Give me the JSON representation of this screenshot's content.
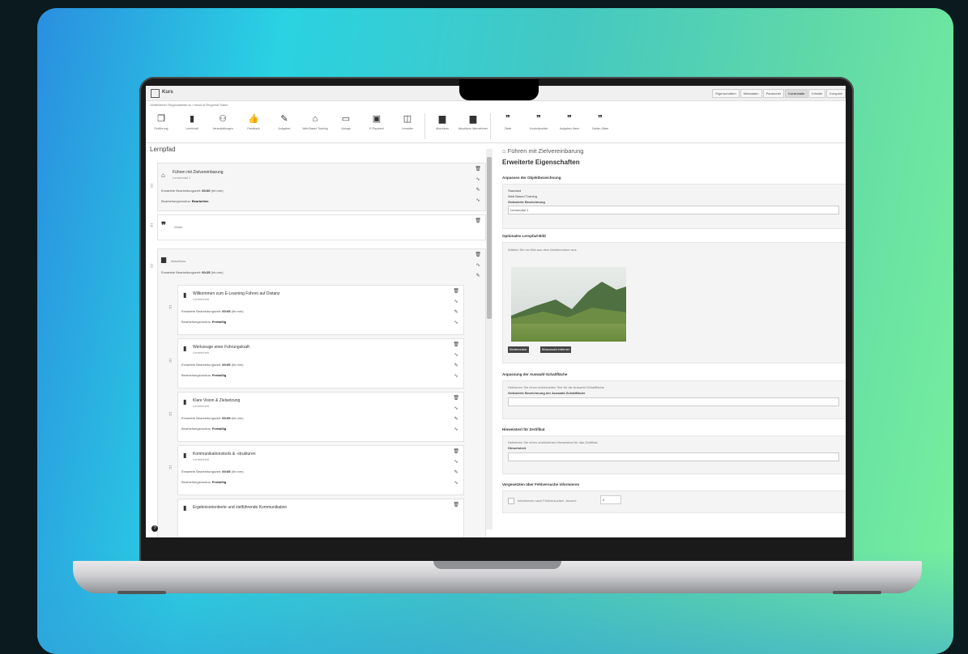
{
  "window": {
    "title": "Kurs"
  },
  "tabs": [
    "Eigenschaften",
    "Metadaten",
    "Parameter",
    "Kursinhalte",
    "Infosite",
    "Kursplan"
  ],
  "breadcrumb": "Zertifizierter Regionalleiter:in / Head of Regional Sales",
  "toolbar": [
    {
      "icon": "document-icon",
      "label": "Einführung",
      "glyph": "❐"
    },
    {
      "icon": "book-icon",
      "label": "Lerninhalt",
      "glyph": "▮"
    },
    {
      "icon": "people-icon",
      "label": "Veranstaltungen",
      "glyph": "⚇"
    },
    {
      "icon": "thumbs-up-icon",
      "label": "Feedback",
      "glyph": "👍"
    },
    {
      "icon": "pen-icon",
      "label": "Aufgaben",
      "glyph": "✎"
    },
    {
      "icon": "robot-icon",
      "label": "Web Based Training",
      "glyph": "⌂"
    },
    {
      "icon": "window-icon",
      "label": "Vorlage",
      "glyph": "▭"
    },
    {
      "icon": "card-icon",
      "label": "E-Payment",
      "glyph": "▣"
    },
    {
      "icon": "box-icon",
      "label": "Lernziele",
      "glyph": "◫"
    },
    {
      "icon": "monitor-icon",
      "label": "Abschluss",
      "glyph": "▆"
    },
    {
      "icon": "user-icon",
      "label": "Abschluss übernehmen",
      "glyph": "▆"
    },
    {
      "icon": "quote-icon",
      "label": "Zitate",
      "glyph": "❞"
    },
    {
      "icon": "quote-icon",
      "label": "Kontrollpunkte",
      "glyph": "❞"
    },
    {
      "icon": "quote-icon",
      "label": "Aufgaben lösen",
      "glyph": "❞"
    },
    {
      "icon": "quote-icon",
      "label": "Zahlen Zitate",
      "glyph": "❞"
    }
  ],
  "left": {
    "heading": "Lernpfad",
    "cards": [
      {
        "title": "Führen mit Zielvereinbarung",
        "subtitle": "Lernmodul 1",
        "meta1_label": "Erwartete Bearbeitungszeit:",
        "meta1_value": "00:00",
        "meta1_unit": "hh:mm",
        "meta2_label": "Bearbeitungsmodus:",
        "meta2_value": "Bearbeiten"
      },
      {
        "title": "Zitate"
      },
      {
        "title": "Abschluss",
        "meta1_label": "Erwartete Bearbeitungszeit:",
        "meta1_value": "00:25",
        "meta1_unit": "hh:mm"
      }
    ],
    "subcards": [
      {
        "title": "Willkommen zum E-Learning Führen auf Distanz",
        "subtitle": "Lerneinheit",
        "meta1_label": "Erwartete Bearbeitungszeit:",
        "meta1_value": "00:05",
        "meta1_unit": "hh:mm",
        "meta2_label": "Bearbeitungsmodus:",
        "meta2_value": "Freiwillig"
      },
      {
        "title": "Werkzeuge einer Führungskraft",
        "subtitle": "Lerneinheit",
        "meta1_label": "Erwartete Bearbeitungszeit:",
        "meta1_value": "00:05",
        "meta1_unit": "hh:mm",
        "meta2_label": "Bearbeitungsmodus:",
        "meta2_value": "Freiwillig"
      },
      {
        "title": "Klare Vision & Zielsetzung",
        "subtitle": "Lerneinheit",
        "meta1_label": "Erwartete Bearbeitungszeit:",
        "meta1_value": "00:05",
        "meta1_unit": "hh:mm",
        "meta2_label": "Bearbeitungsmodus:",
        "meta2_value": "Freiwillig"
      },
      {
        "title": "Kommunikationstools & -strukturen",
        "subtitle": "Lerneinheit",
        "meta1_label": "Erwartete Bearbeitungszeit:",
        "meta1_value": "00:05",
        "meta1_unit": "hh:mm",
        "meta2_label": "Bearbeitungsmodus:",
        "meta2_value": "Freiwillig"
      },
      {
        "title": "Ergebnisorientierte und zielführende Kommunikation"
      }
    ]
  },
  "right": {
    "header": "Führen mit Zielvereinbarung",
    "title": "Erweiterte Eigenschaften",
    "s1": {
      "heading": "Anpassen der Objektbezeichnung",
      "line1": "Standard",
      "line2": "Web Based Training",
      "label": "Geänderte Bezeichnung",
      "value": "Lernmodul 1"
    },
    "s2": {
      "heading": "Optionales Lernpfad-Bild",
      "hint": "Wählen Sie ein Bild aus dem Medienordner aus.",
      "btn1": "Medienordner",
      "btn2": "Bildauswahl entfernen"
    },
    "s3": {
      "heading": "Anpassung der Auswahl-Schaltfläche",
      "hint": "Definieren Sie einen individuellen Text für die Auswahl-Schaltfläche.",
      "label": "Geänderte Bezeichnung der Auswahl-Schaltfläche"
    },
    "s4": {
      "heading": "Hinweistext für Zertifikat",
      "hint": "Definieren Sie einen zusätzlichen Hinweistext für das Zertifikat.",
      "label": "Hinweistext"
    },
    "s5": {
      "heading": "Vorgesetzten über Fehlversuche informieren",
      "label": "Informieren nach Fehlversuchen. Anzahl:",
      "value": "0"
    }
  },
  "colors": {
    "bg_start": "#2a8fe0",
    "bg_mid": "#2ad2e2",
    "bg_end": "#78f09c",
    "frame": "#0b1a1e"
  }
}
